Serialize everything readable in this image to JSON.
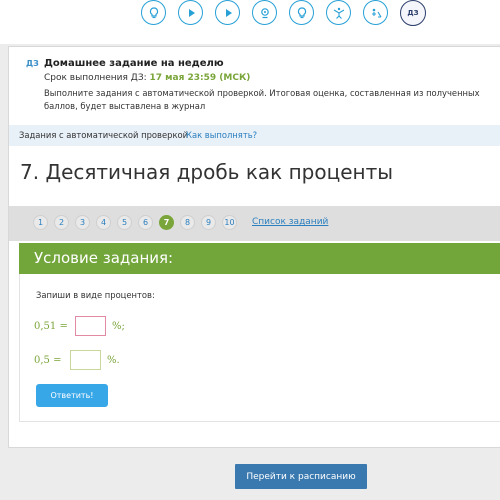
{
  "nav": {
    "icons": [
      "lightbulb-icon",
      "play-icon",
      "play-icon",
      "webcam-icon",
      "lightbulb-icon",
      "gymnast-icon",
      "worker-icon",
      "homework-icon"
    ],
    "dz_label": "ДЗ"
  },
  "homework": {
    "tag": "ДЗ",
    "title": "Домашнее задание на неделю",
    "deadline_label": "Срок выполнения ДЗ: ",
    "deadline_date": "17 мая 23:59 (МСК)",
    "description": "Выполните задания с автоматической проверкой. Итоговая оценка, составленная из полученных баллов, будет выставлена в журнал"
  },
  "auto_check": {
    "label": "Задания с автоматической проверкой",
    "link": "Как выполнять?"
  },
  "task": {
    "title": "7. Десятичная дробь как проценты"
  },
  "pagination": {
    "pages": [
      "1",
      "2",
      "3",
      "4",
      "5",
      "6",
      "7",
      "8",
      "9",
      "10"
    ],
    "active": "7",
    "list_link": "Список заданий"
  },
  "condition": {
    "header": "Условие задания:",
    "instruction": "Запиши в виде процентов:",
    "eq1_left": "0,51 =",
    "eq1_unit": "%;",
    "eq2_left": "0,5 =",
    "eq2_unit": "%.",
    "answer_button": "Ответить!"
  },
  "schedule_button": "Перейти к расписанию",
  "colors": {
    "accent_green": "#72a53a",
    "link_blue": "#2a7fbf",
    "button_blue": "#38a7e8",
    "schedule_blue": "#3a79b0"
  }
}
